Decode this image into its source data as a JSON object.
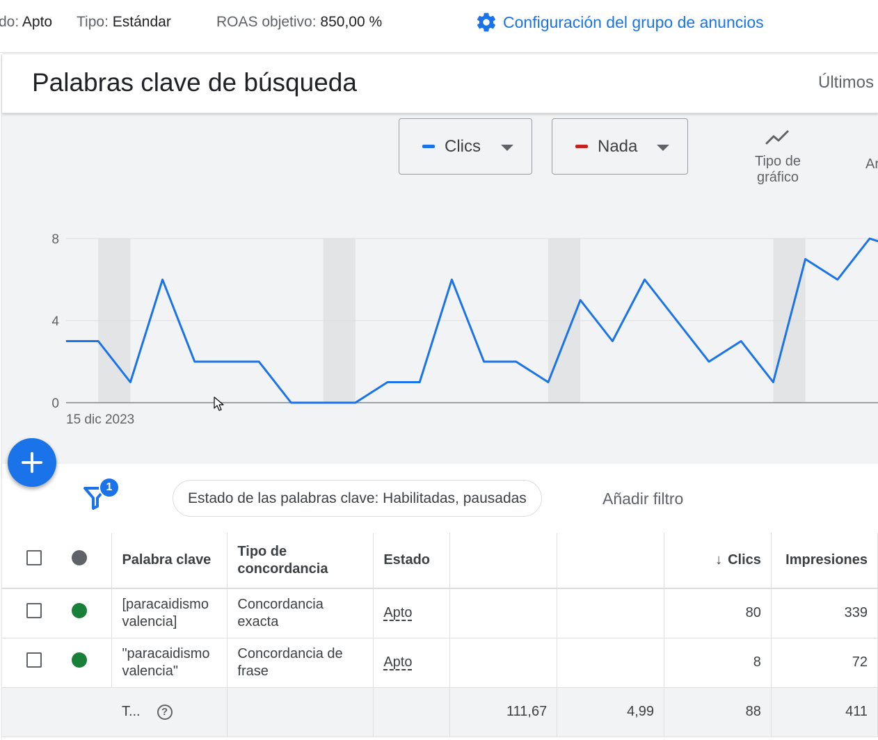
{
  "topbar": {
    "status_label": "do:",
    "status_value": "Apto",
    "type_label": "Tipo:",
    "type_value": "Estándar",
    "roas_label": "ROAS objetivo:",
    "roas_value": "850,00 %",
    "settings_link": "Configuración del grupo de anuncios"
  },
  "card": {
    "title": "Palabras clave de búsqueda",
    "date_range": "Últimos"
  },
  "chart_controls": {
    "metric1": {
      "label": "Clics",
      "color": "#1a73e8"
    },
    "metric2": {
      "label": "Nada",
      "color": "#c5221f"
    },
    "chart_type_label": "Tipo de gráfico",
    "extra_label": "Ar"
  },
  "chart_data": {
    "type": "line",
    "series": [
      {
        "name": "Clics",
        "color": "#1a73e8",
        "values": [
          3,
          3,
          1,
          6,
          2,
          2,
          2,
          0,
          0,
          0,
          1,
          1,
          6,
          2,
          2,
          1,
          5,
          3,
          6,
          4,
          2,
          3,
          1,
          7,
          6,
          8,
          7.5
        ]
      }
    ],
    "yticks": [
      0,
      4,
      8
    ],
    "ylim": [
      0,
      8
    ],
    "x_start_label": "15 dic 2023",
    "weekend_band_indices": [
      1,
      8,
      15,
      22
    ]
  },
  "filters": {
    "badge_count": "1",
    "chip": "Estado de las palabras clave: Habilitadas, pausadas",
    "add_filter": "Añadir filtro"
  },
  "table": {
    "headers": {
      "keyword": "Palabra clave",
      "match_type": "Tipo de concordancia",
      "status": "Estado",
      "col4": "",
      "col5": "",
      "clicks": "Clics",
      "impressions": "Impresiones"
    },
    "rows": [
      {
        "keyword": "[paracaidismo valencia]",
        "match_type": "Concordancia exacta",
        "status": "Apto",
        "col4": "",
        "col5": "",
        "clicks": "80",
        "impressions": "339",
        "dot_color": "#188038"
      },
      {
        "keyword": "\"paracaidismo valencia\"",
        "match_type": "Concordancia de frase",
        "status": "Apto",
        "col4": "",
        "col5": "",
        "clicks": "8",
        "impressions": "72",
        "dot_color": "#188038"
      }
    ],
    "total": {
      "label": "T...",
      "col4": "111,67",
      "col5": "4,99",
      "clicks": "88",
      "impressions": "411"
    },
    "header_dot_color": "#5f6368"
  }
}
